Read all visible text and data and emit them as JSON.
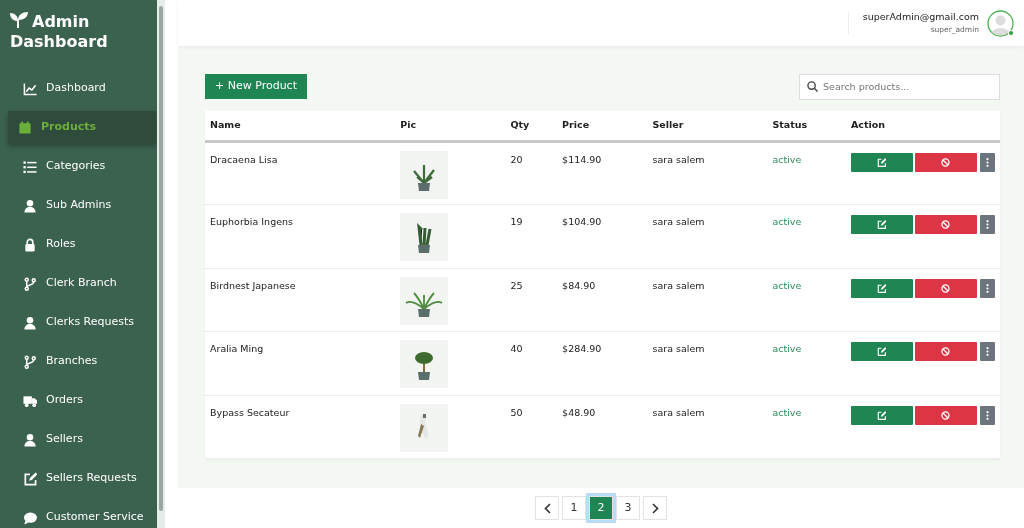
{
  "brand": {
    "title": "Admin Dashboard"
  },
  "sidebar": {
    "items": [
      {
        "label": "Dashboard",
        "selected": false
      },
      {
        "label": "Products",
        "selected": true
      },
      {
        "label": "Categories",
        "selected": false
      },
      {
        "label": "Sub Admins",
        "selected": false
      },
      {
        "label": "Roles",
        "selected": false
      },
      {
        "label": "Clerk Branch",
        "selected": false
      },
      {
        "label": "Clerks Requests",
        "selected": false
      },
      {
        "label": "Branches",
        "selected": false
      },
      {
        "label": "Orders",
        "selected": false
      },
      {
        "label": "Sellers",
        "selected": false
      },
      {
        "label": "Sellers Requests",
        "selected": false
      },
      {
        "label": "Customer Service",
        "selected": false
      }
    ]
  },
  "user": {
    "email": "superAdmin@gmail.com",
    "role": "super_admin",
    "online": true
  },
  "toolbar": {
    "new_button": "+ New Product",
    "search": {
      "placeholder": "Search products..."
    }
  },
  "table": {
    "columns": [
      "Name",
      "Pic",
      "Qty",
      "Price",
      "Seller",
      "Status",
      "Action"
    ],
    "rows": [
      {
        "name": "Dracaena Lisa",
        "qty": "20",
        "price": "$114.90",
        "seller": "sara salem",
        "status": "active"
      },
      {
        "name": "Euphorbia Ingens",
        "qty": "19",
        "price": "$104.90",
        "seller": "sara salem",
        "status": "active"
      },
      {
        "name": "Birdnest Japanese",
        "qty": "25",
        "price": "$84.90",
        "seller": "sara salem",
        "status": "active"
      },
      {
        "name": "Aralia Ming",
        "qty": "40",
        "price": "$284.90",
        "seller": "sara salem",
        "status": "active"
      },
      {
        "name": "Bypass Secateur",
        "qty": "50",
        "price": "$48.90",
        "seller": "sara salem",
        "status": "active"
      }
    ]
  },
  "pagination": {
    "pages": [
      {
        "label": "1",
        "selected": false
      },
      {
        "label": "2",
        "selected": true
      },
      {
        "label": "3",
        "selected": false
      }
    ]
  }
}
